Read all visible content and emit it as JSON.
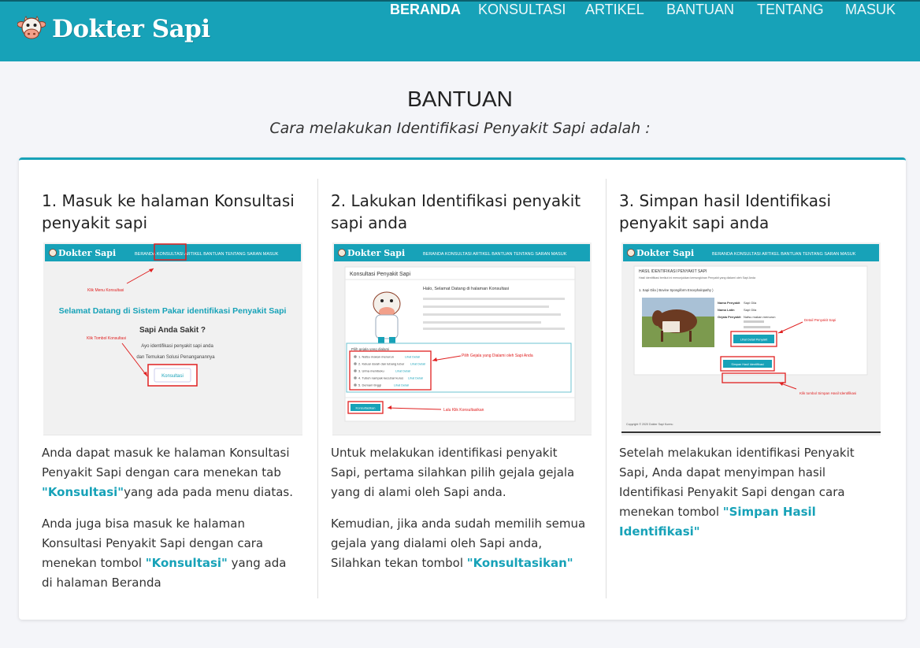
{
  "brand": {
    "name": "Dokter Sapi",
    "logo_icon": "cow-face-icon"
  },
  "nav": {
    "items": [
      {
        "label": "BERANDA",
        "active": true
      },
      {
        "label": "KONSULTASI"
      },
      {
        "label": "ARTIKEL"
      },
      {
        "label": "BANTUAN"
      },
      {
        "label": "TENTANG"
      },
      {
        "label": "MASUK"
      }
    ]
  },
  "page": {
    "title": "BANTUAN",
    "subtitle": "Cara melakukan Identifikasi Penyakit Sapi adalah :"
  },
  "steps": [
    {
      "title": "1. Masuk ke halaman Konsultasi penyakit sapi",
      "p1_before": "Anda dapat masuk ke halaman Konsultasi Penyakit Sapi dengan cara menekan tab ",
      "p1_highlight": "\"Konsultasi\"",
      "p1_after": "yang ada pada menu diatas.",
      "p2_before": "Anda juga bisa masuk ke halaman Konsultasi Penyakit Sapi dengan cara menekan tombol ",
      "p2_highlight": "\"Konsultasi\"",
      "p2_after": " yang ada di halaman Beranda",
      "screenshot": {
        "brand": "Dokter Sapi",
        "nav": "BERANDA   KONSULTASI   ARTIKEL   BANTUAN   TENTANG   SARAN   MASUK",
        "note1": "Klik Menu Konsultasi",
        "heading": "Selamat Datang di Sistem Pakar identifikasi Penyakit Sapi",
        "question": "Sapi Anda Sakit ?",
        "line1": "Ayo identifikasi penyakit sapi anda",
        "line2": "dan Temukan Solusi Penanganannya",
        "note2": "Klik Tombol Konsultasi",
        "button": "Konsultasi"
      }
    },
    {
      "title": "2. Lakukan Identifikasi penyakit sapi anda",
      "p1_before": "Untuk melakukan identifikasi penyakit Sapi, pertama silahkan pilih gejala gejala yang di alami oleh Sapi anda.",
      "p2_before": "Kemudian, jika anda sudah memilih semua gejala yang dialami oleh Sapi anda, Silahkan tekan tombol ",
      "p2_highlight": "\"Konsultasikan\"",
      "screenshot": {
        "brand": "Dokter Sapi",
        "nav": "BERANDA   KONSULTASI   ARTIKEL   BANTUAN   TENTANG   SARAN   MASUK",
        "panel_title": "Konsultasi Penyakit Sapi",
        "greeting": "Halo, Selamat Datang di halaman Konsultasi",
        "note1": "Pilih Gejala yang Dialami oleh Sapi Anda",
        "list_title": "Pilih gejala yang dialami",
        "options": [
          "1. Nafsu makan menurun",
          "2. Keluar darah dan lubang lubur",
          "3. Urina membeku",
          "4. Tubuh nampak kecubar kurus",
          "5. Demam tinggi"
        ],
        "option_link": "Lihat Detail",
        "button": "Konsultasikan",
        "note2": "Lalu Klik Konsultasikan"
      }
    },
    {
      "title": "3. Simpan hasil Identifikasi penyakit sapi anda",
      "p1_before": "Setelah melakukan identifikasi Penyakit Sapi, Anda dapat menyimpan hasil Identifikasi Penyakit Sapi dengan cara menekan tombol ",
      "p1_highlight": "\"Simpan Hasil Identifikasi\"",
      "screenshot": {
        "brand": "Dokter Sapi",
        "nav": "BERANDA   KONSULTASI   ARTIKEL   BANTUAN   TENTANG   SARAN   MASUK",
        "panel_title": "HASIL IDENTIFIKASI PENYAKIT SAPI",
        "panel_sub": "Hasil identifikasi berikut ini menunjukkan kemungkinan Penyakit yang dialami oleh Sapi Anda",
        "item": "1. Sapi Gila ( Bovine Spongiform Encephalopathy )",
        "labels": [
          "Nama Penyakit",
          "Nama Latin",
          "Gejala Penyakit"
        ],
        "values": [
          "Sapi Gila",
          "Sapi Gila",
          "Nafsu makan menurun"
        ],
        "detail_button": "Lihat Detail Penyakit",
        "note1": "Detail Penyakit Sapi",
        "save_button": "Simpan Hasil Identifikasi",
        "note2": "Klik tombol Simpan Hasil Identifikasi",
        "footer": "Copyright © 2020 Dokter Sapi Kurmu"
      }
    }
  ],
  "colors": {
    "primary": "#17a2b8",
    "annotation": "#e02020"
  }
}
